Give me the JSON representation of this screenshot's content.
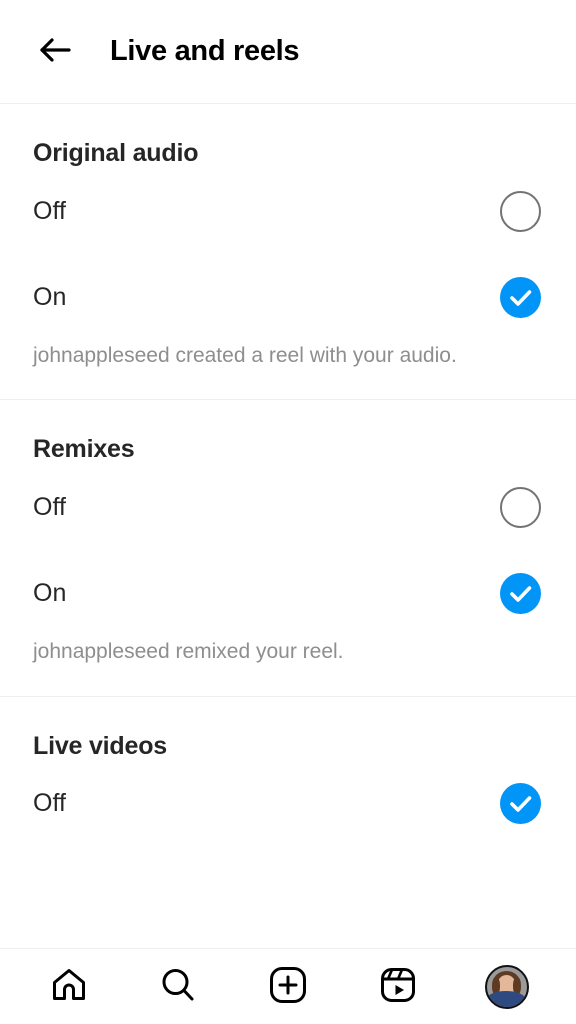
{
  "header": {
    "back_icon": "arrow-left-icon",
    "title": "Live and reels"
  },
  "sections": [
    {
      "id": "original-audio",
      "title": "Original audio",
      "options": [
        {
          "label": "Off",
          "selected": false
        },
        {
          "label": "On",
          "selected": true
        }
      ],
      "helper": "johnappleseed created a reel with your audio."
    },
    {
      "id": "remixes",
      "title": "Remixes",
      "options": [
        {
          "label": "Off",
          "selected": false
        },
        {
          "label": "On",
          "selected": true
        }
      ],
      "helper": "johnappleseed remixed your reel."
    },
    {
      "id": "live-videos",
      "title": "Live videos",
      "options": [
        {
          "label": "Off",
          "selected": true
        }
      ],
      "helper": ""
    }
  ],
  "bottom_nav": [
    {
      "id": "home",
      "icon": "home-icon"
    },
    {
      "id": "search",
      "icon": "search-icon"
    },
    {
      "id": "create",
      "icon": "plus-square-icon"
    },
    {
      "id": "reels",
      "icon": "reels-icon"
    },
    {
      "id": "profile",
      "icon": "avatar-icon"
    }
  ],
  "colors": {
    "accent_blue": "#0095f6",
    "radio_border": "#737373",
    "text_primary": "#262626",
    "text_secondary": "#8e8e8e",
    "divider": "#efefef"
  }
}
